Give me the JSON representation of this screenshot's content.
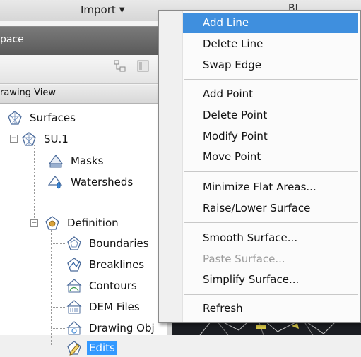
{
  "ribbon": {
    "import_label": "Import",
    "right_label": "Bl"
  },
  "panel": {
    "title": "pace",
    "tree_header": "rawing View",
    "tree": [
      {
        "label": "Surfaces",
        "icon": "surfaces-icon",
        "selected": false
      },
      {
        "label": "SU.1",
        "icon": "surface-icon",
        "selected": false
      },
      {
        "label": "Masks",
        "icon": "masks-icon",
        "selected": false
      },
      {
        "label": "Watersheds",
        "icon": "watersheds-icon",
        "selected": false
      },
      {
        "label": "Definition",
        "icon": "definition-icon",
        "selected": false
      },
      {
        "label": "Boundaries",
        "icon": "boundaries-icon",
        "selected": false
      },
      {
        "label": "Breaklines",
        "icon": "breaklines-icon",
        "selected": false
      },
      {
        "label": "Contours",
        "icon": "contours-icon",
        "selected": false
      },
      {
        "label": "DEM Files",
        "icon": "dem-files-icon",
        "selected": false
      },
      {
        "label": "Drawing Obj",
        "icon": "drawing-objects-icon",
        "selected": false
      },
      {
        "label": "Edits",
        "icon": "edits-icon",
        "selected": true
      }
    ]
  },
  "context_menu": {
    "items": [
      {
        "label": "Add Line",
        "state": "highlighted"
      },
      {
        "label": "Delete Line",
        "state": "normal"
      },
      {
        "label": "Swap Edge",
        "state": "normal"
      },
      {
        "label": "Add Point",
        "state": "normal"
      },
      {
        "label": "Delete Point",
        "state": "normal"
      },
      {
        "label": "Modify Point",
        "state": "normal"
      },
      {
        "label": "Move Point",
        "state": "normal"
      },
      {
        "label": "Minimize Flat Areas...",
        "state": "normal"
      },
      {
        "label": "Raise/Lower Surface",
        "state": "normal"
      },
      {
        "label": "Smooth Surface...",
        "state": "normal"
      },
      {
        "label": "Paste Surface...",
        "state": "disabled"
      },
      {
        "label": "Simplify Surface...",
        "state": "normal"
      },
      {
        "label": "Refresh",
        "state": "normal"
      }
    ]
  },
  "colors": {
    "highlight": "#3f8fde",
    "selection": "#3399ff",
    "disabled_text": "#9c9c9c",
    "drawing_background": "#1b1d22"
  }
}
